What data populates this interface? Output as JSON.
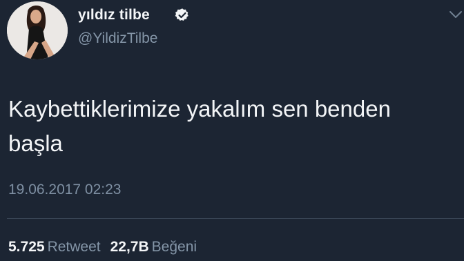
{
  "tweet": {
    "author": {
      "display_name": "yıldız tilbe",
      "handle": "@YildizTilbe",
      "verified": true
    },
    "text": "Kaybettiklerimize yakalım sen benden\nbaşla",
    "timestamp": "19.06.2017 02:23",
    "stats": {
      "retweets": {
        "count": "5.725",
        "label": "Retweet"
      },
      "likes": {
        "count": "22,7B",
        "label": "Beğeni"
      }
    }
  },
  "icons": {
    "verified": "verified-badge-icon",
    "menu": "chevron-down-icon"
  },
  "colors": {
    "background": "#1c2533",
    "primary_text": "#f3f5f7",
    "secondary_text": "#8596a8",
    "divider": "#3a4656"
  }
}
